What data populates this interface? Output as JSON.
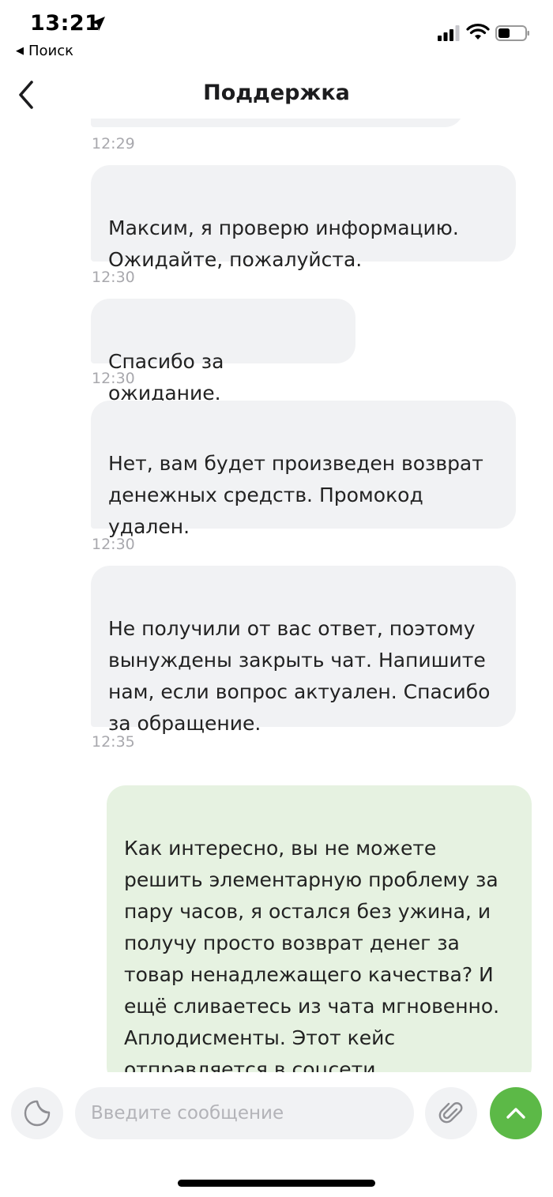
{
  "status_bar": {
    "time": "13:21",
    "back_app_label": "Поиск",
    "icons": [
      "location-arrow-icon",
      "cellular-signal-icon",
      "wifi-icon",
      "battery-icon"
    ]
  },
  "header": {
    "title": "Поддержка",
    "back_icon": "chevron-left-icon"
  },
  "messages": [
    {
      "from": "support",
      "text": "",
      "time": "12:29"
    },
    {
      "from": "support",
      "text": "Максим, я проверю информацию.\nОжидайте, пожалуйста.",
      "time": "12:30"
    },
    {
      "from": "support",
      "text": "Спасибо за ожидание.",
      "time": "12:30"
    },
    {
      "from": "support",
      "text": "Нет, вам будет произведен возврат\nденежных средств. Промокод\nудален.",
      "time": "12:30"
    },
    {
      "from": "support",
      "text": "Не получили от вас ответ, поэтому\nвынуждены закрыть чат. Напишите\nнам, если вопрос актуален. Спасибо\nза обращение.",
      "time": "12:35"
    },
    {
      "from": "user",
      "text": "Как интересно, вы не можете\nрешить элементарную проблему за\nпару часов, я остался без ужина, и\nполучу просто возврат денег за\nтовар ненадлежащего качества? И\nещё сливаетесь из чата мгновенно.\nАплодисменты. Этот кейс\nотправляется в соцсети",
      "time": ""
    }
  ],
  "composer": {
    "placeholder": "Введите сообщение",
    "value": "",
    "sticker_icon": "sticker-icon",
    "attach_icon": "paperclip-icon",
    "send_icon": "chevron-up-icon"
  },
  "colors": {
    "incoming_bubble": "#f1f2f4",
    "outgoing_bubble": "#e6f2e1",
    "accent_green": "#5cb947",
    "timestamp": "#a8a8ad"
  }
}
